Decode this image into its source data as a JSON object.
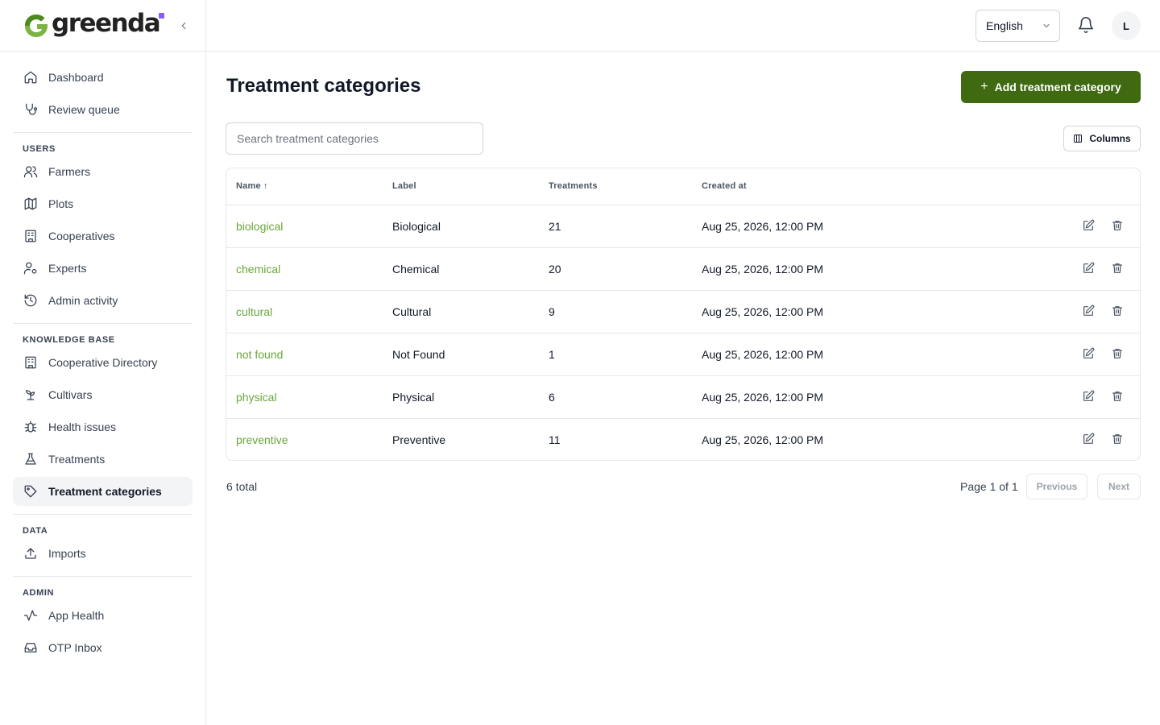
{
  "brand": {
    "name": "greenda",
    "accent": "#3f6a12",
    "link_color": "#6aa53a",
    "dot_color": "#8b5cf6"
  },
  "sidebar": {
    "top_items": [
      {
        "label": "Dashboard",
        "icon": "home-icon"
      },
      {
        "label": "Review queue",
        "icon": "stethoscope-icon"
      }
    ],
    "sections": [
      {
        "title": "USERS",
        "items": [
          {
            "label": "Farmers",
            "icon": "users-icon"
          },
          {
            "label": "Plots",
            "icon": "map-icon"
          },
          {
            "label": "Cooperatives",
            "icon": "building-icon"
          },
          {
            "label": "Experts",
            "icon": "user-cog-icon"
          },
          {
            "label": "Admin activity",
            "icon": "history-icon"
          }
        ]
      },
      {
        "title": "KNOWLEDGE BASE",
        "items": [
          {
            "label": "Cooperative Directory",
            "icon": "building-icon"
          },
          {
            "label": "Cultivars",
            "icon": "sprout-icon"
          },
          {
            "label": "Health issues",
            "icon": "bug-icon"
          },
          {
            "label": "Treatments",
            "icon": "flask-icon"
          },
          {
            "label": "Treatment categories",
            "icon": "tag-icon",
            "active": true
          }
        ]
      },
      {
        "title": "DATA",
        "items": [
          {
            "label": "Imports",
            "icon": "upload-icon"
          }
        ]
      },
      {
        "title": "ADMIN",
        "items": [
          {
            "label": "App Health",
            "icon": "activity-icon"
          },
          {
            "label": "OTP Inbox",
            "icon": "inbox-icon"
          }
        ]
      }
    ]
  },
  "header": {
    "language": "English",
    "avatar_initial": "L"
  },
  "main": {
    "title": "Treatment categories",
    "add_button": "Add treatment category",
    "search_placeholder": "Search treatment categories",
    "columns_button": "Columns",
    "table": {
      "headers": {
        "name": "Name",
        "sort_indicator": "↑",
        "label": "Label",
        "treatments": "Treatments",
        "created_at": "Created at"
      },
      "rows": [
        {
          "name": "biological",
          "label": "Biological",
          "treatments": "21",
          "created_at": "Aug 25, 2026, 12:00 PM"
        },
        {
          "name": "chemical",
          "label": "Chemical",
          "treatments": "20",
          "created_at": "Aug 25, 2026, 12:00 PM"
        },
        {
          "name": "cultural",
          "label": "Cultural",
          "treatments": "9",
          "created_at": "Aug 25, 2026, 12:00 PM"
        },
        {
          "name": "not found",
          "label": "Not Found",
          "treatments": "1",
          "created_at": "Aug 25, 2026, 12:00 PM"
        },
        {
          "name": "physical",
          "label": "Physical",
          "treatments": "6",
          "created_at": "Aug 25, 2026, 12:00 PM"
        },
        {
          "name": "preventive",
          "label": "Preventive",
          "treatments": "11",
          "created_at": "Aug 25, 2026, 12:00 PM"
        }
      ]
    },
    "footer": {
      "total": "6 total",
      "page_info": "Page 1 of 1",
      "previous": "Previous",
      "next": "Next"
    }
  }
}
